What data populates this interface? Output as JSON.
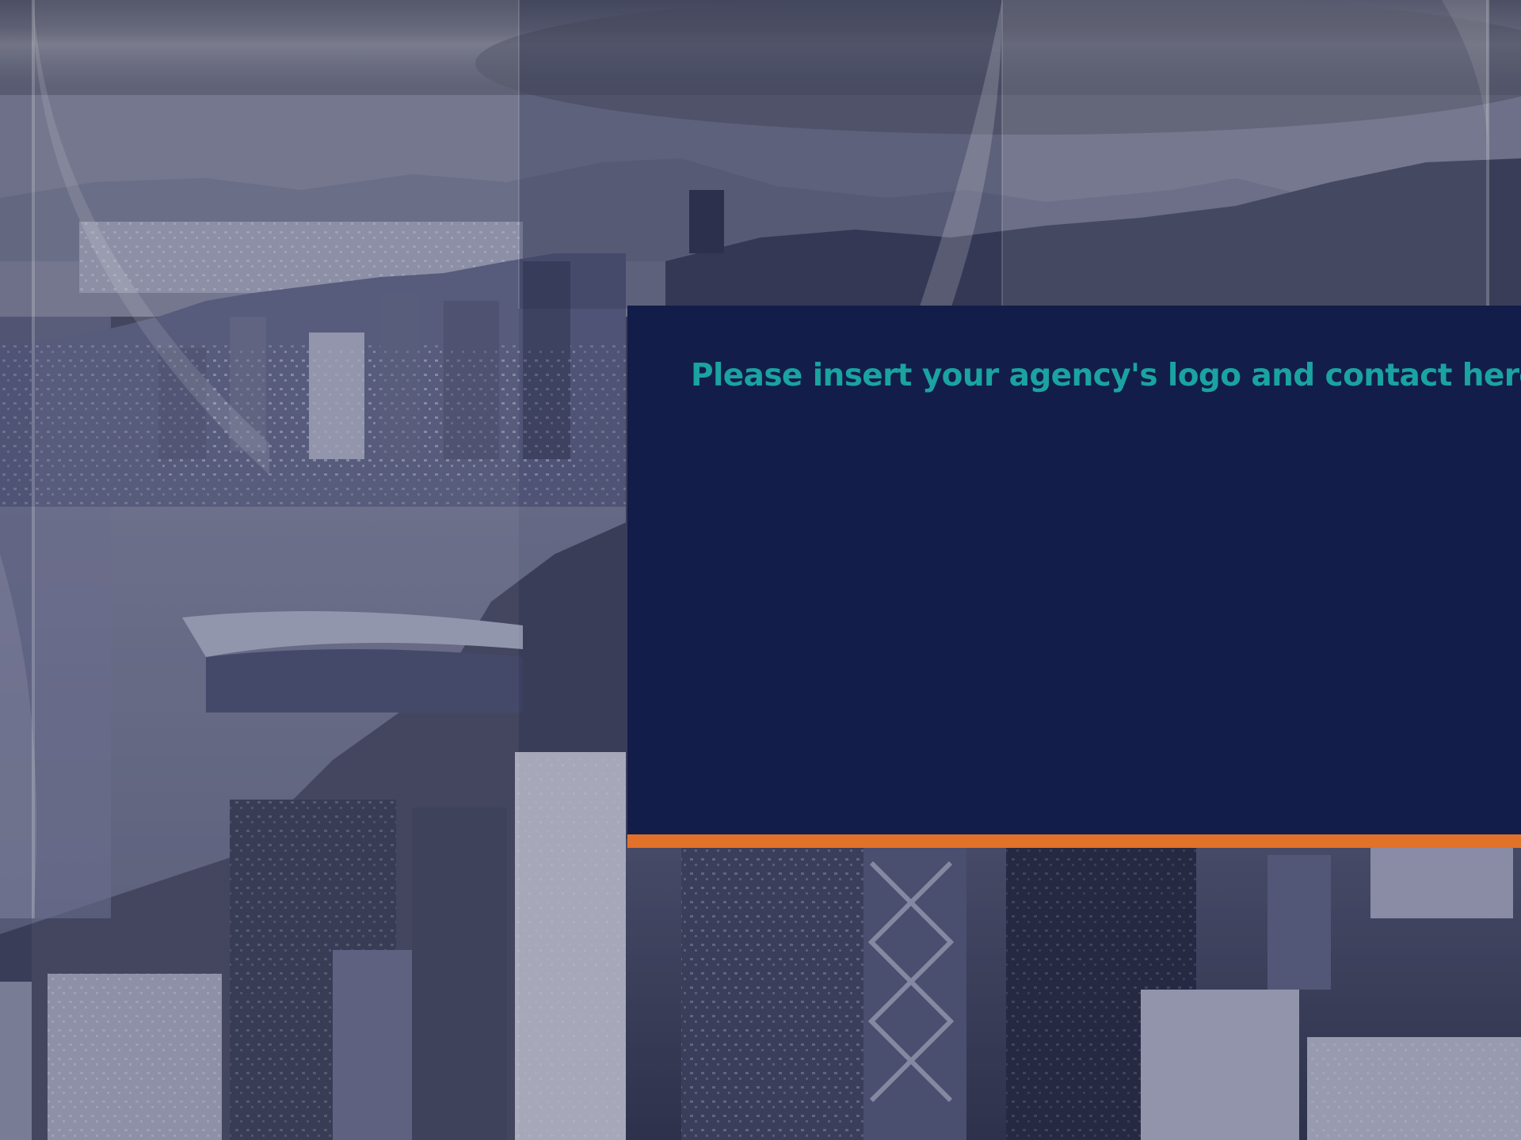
{
  "slide": {
    "placeholder_text": "Please insert your agency's logo and contact here.",
    "background_image": "city-harbour-skyline-photo",
    "colors": {
      "panel": "#131d4a",
      "text": "#1aa3a0",
      "accent_bar": "#e2712a",
      "photo_tint": "#3d4266"
    }
  }
}
